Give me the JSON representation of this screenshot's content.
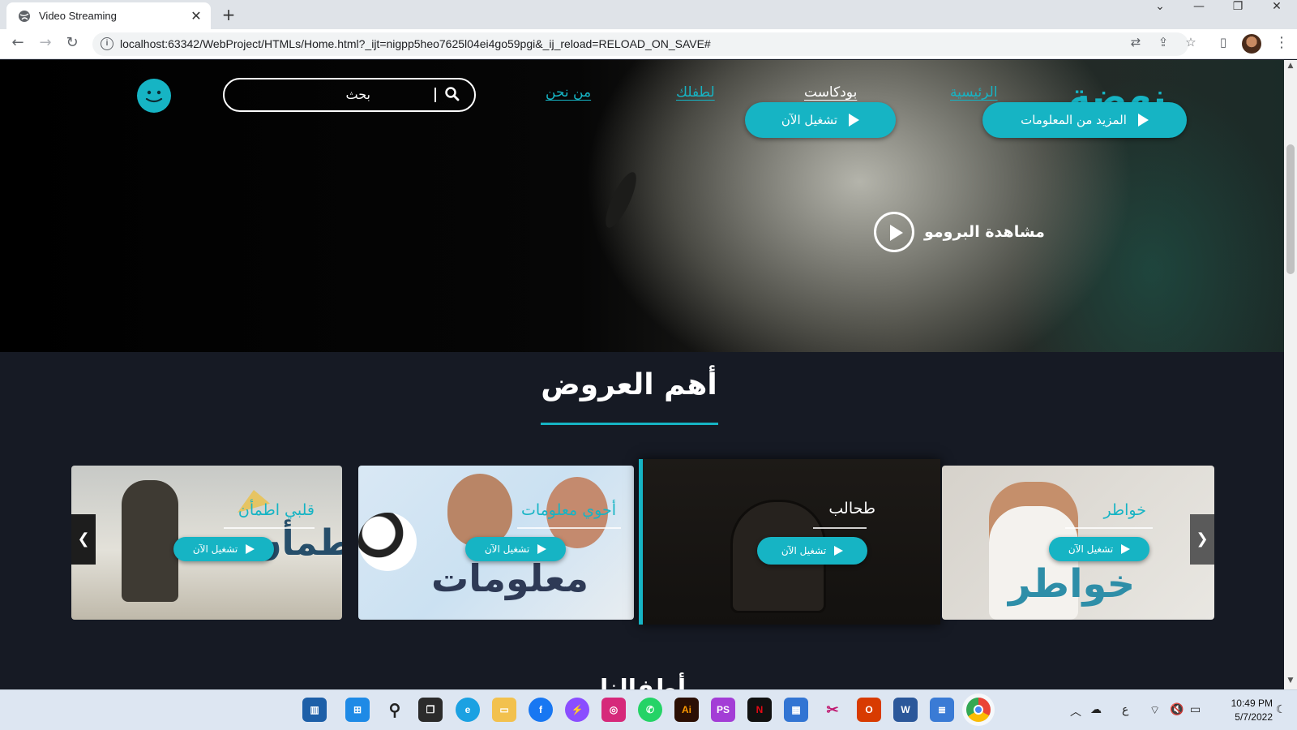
{
  "browser": {
    "tab_title": "Video Streaming",
    "url": "localhost:63342/WebProject/HTMLs/Home.html?_ijt=nigpp5heo7625l04ei4go59pgi&_ij_reload=RELOAD_ON_SAVE#"
  },
  "site": {
    "logo": "نهضة",
    "nav": {
      "home": "الرئيسية",
      "podcast": "بودكاست",
      "kids": "لطفلك",
      "about": "من نحن"
    },
    "search_placeholder": "بحث"
  },
  "hero": {
    "more_info": "المزيد من المعلومات",
    "play_now": "تشغيل الآن",
    "watch_promo": "مشاهدة البرومو"
  },
  "offers": {
    "title": "أهم العروض",
    "cards": [
      {
        "caption": "قلبي اطمأن",
        "play": "تشغيل الآن"
      },
      {
        "caption": "أحوي معلومات",
        "play": "تشغيل الآن"
      },
      {
        "caption": "طحالب",
        "play": "تشغيل الآن"
      },
      {
        "caption": "خواطر",
        "play": "تشغيل الآن"
      }
    ],
    "card_art": [
      "اطمأن",
      "معلومات",
      "",
      "خواطر"
    ]
  },
  "next_section_title": "أطفالنا",
  "colors": {
    "accent": "#16b4c4",
    "page_bg": "#161a24"
  },
  "taskbar": {
    "time": "10:49 PM",
    "date": "5/7/2022",
    "lang": "ع"
  }
}
